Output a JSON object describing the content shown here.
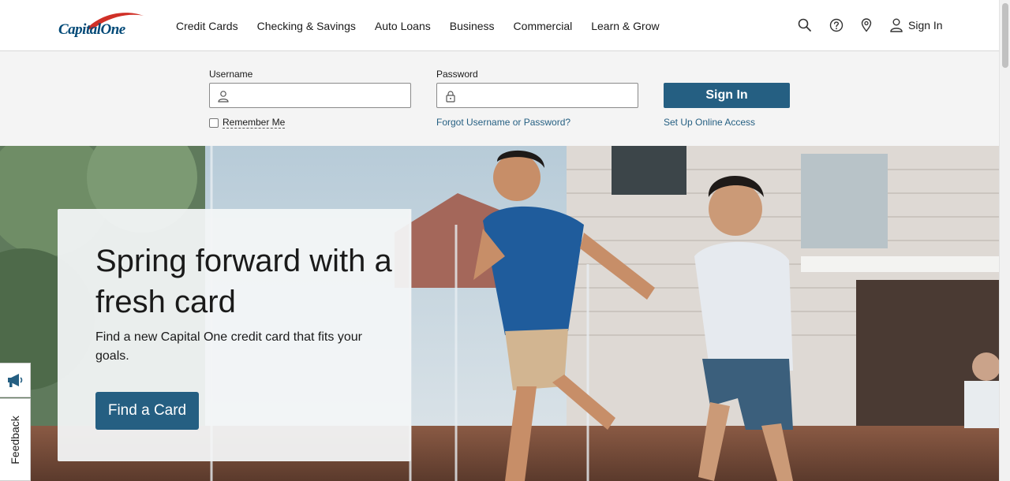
{
  "brand": {
    "logo_text": "CapitalOne",
    "primary_color": "#255f82",
    "logo_color": "#004977",
    "accent_red": "#d03027"
  },
  "nav": {
    "items": [
      "Credit Cards",
      "Checking & Savings",
      "Auto Loans",
      "Business",
      "Commercial",
      "Learn & Grow"
    ]
  },
  "utility": {
    "icons": [
      "search-icon",
      "help-icon",
      "location-pin-icon",
      "user-icon"
    ],
    "sign_in_label": "Sign In"
  },
  "login": {
    "username_label": "Username",
    "username_value": "",
    "password_label": "Password",
    "password_value": "",
    "remember_label": "Remember Me",
    "remember_checked": false,
    "forgot_link": "Forgot Username or Password?",
    "setup_link": "Set Up Online Access",
    "submit_label": "Sign In"
  },
  "hero": {
    "title": "Spring forward with a fresh card",
    "body": "Find a new Capital One credit card that fits your goals.",
    "cta_label": "Find a Card"
  },
  "feedback": {
    "label": "Feedback"
  }
}
